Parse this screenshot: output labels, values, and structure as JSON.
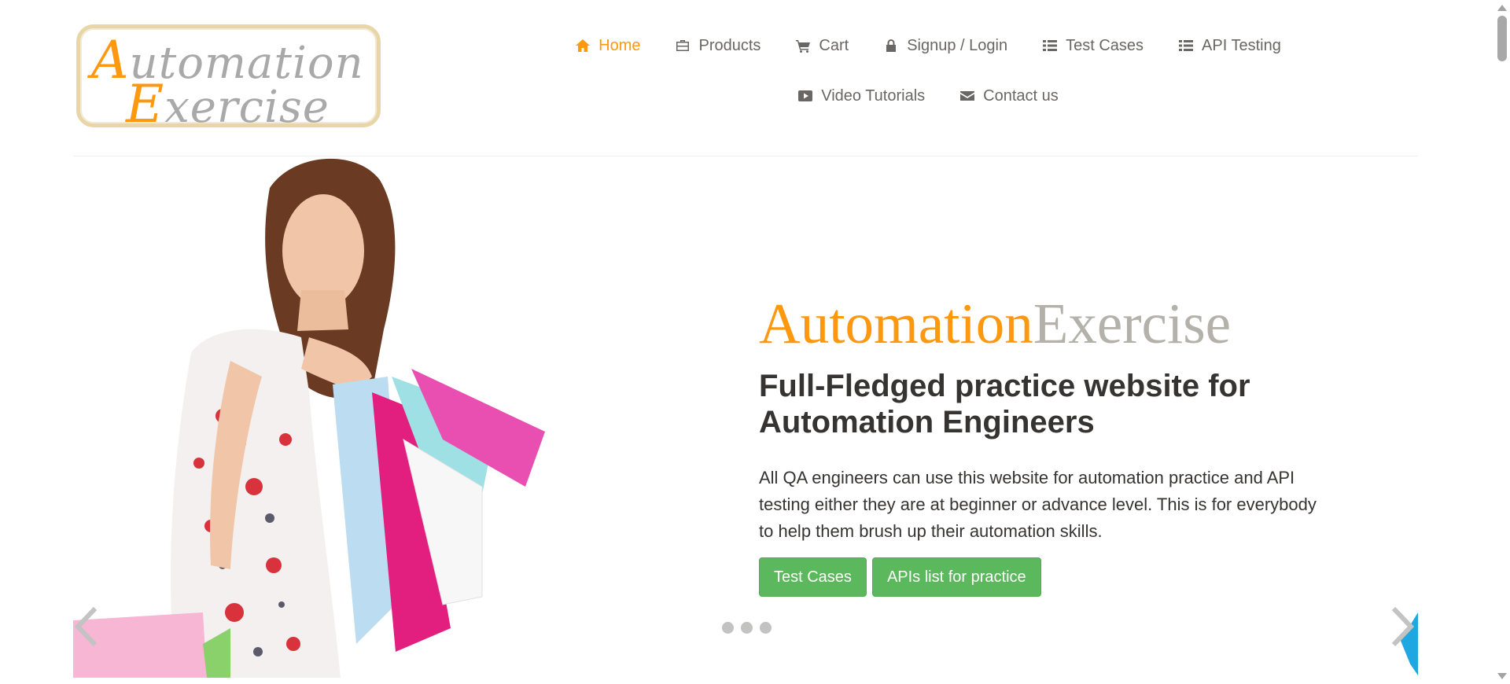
{
  "logo": {
    "line1_cap": "A",
    "line1_rest": "utomation",
    "line2_cap": "E",
    "line2_rest": "xercise"
  },
  "nav": {
    "items": [
      {
        "label": "Home",
        "icon": "home-icon",
        "active": true
      },
      {
        "label": "Products",
        "icon": "briefcase-icon"
      },
      {
        "label": "Cart",
        "icon": "shopping-cart-icon"
      },
      {
        "label": "Signup / Login",
        "icon": "lock-icon"
      },
      {
        "label": "Test Cases",
        "icon": "list-icon"
      },
      {
        "label": "API Testing",
        "icon": "list-icon"
      },
      {
        "label": "Video Tutorials",
        "icon": "youtube-play-icon"
      },
      {
        "label": "Contact us",
        "icon": "envelope-icon"
      }
    ]
  },
  "slider": {
    "brand_part1": "Automation",
    "brand_part2": "Exercise",
    "headline": "Full-Fledged practice website for Automation Engineers",
    "description": "All QA engineers can use this website for automation practice and API testing either they are at beginner or advance level. This is for everybody to help them brush up their automation skills.",
    "buttons": [
      "Test Cases",
      "APIs list for practice"
    ],
    "slide_count": 3,
    "active_slide": 1
  },
  "colors": {
    "accent": "#fe980f",
    "brand_gray": "#b4b1ab",
    "button_green": "#5cb85c",
    "text_dark": "#363432",
    "nav_text": "#696763"
  }
}
